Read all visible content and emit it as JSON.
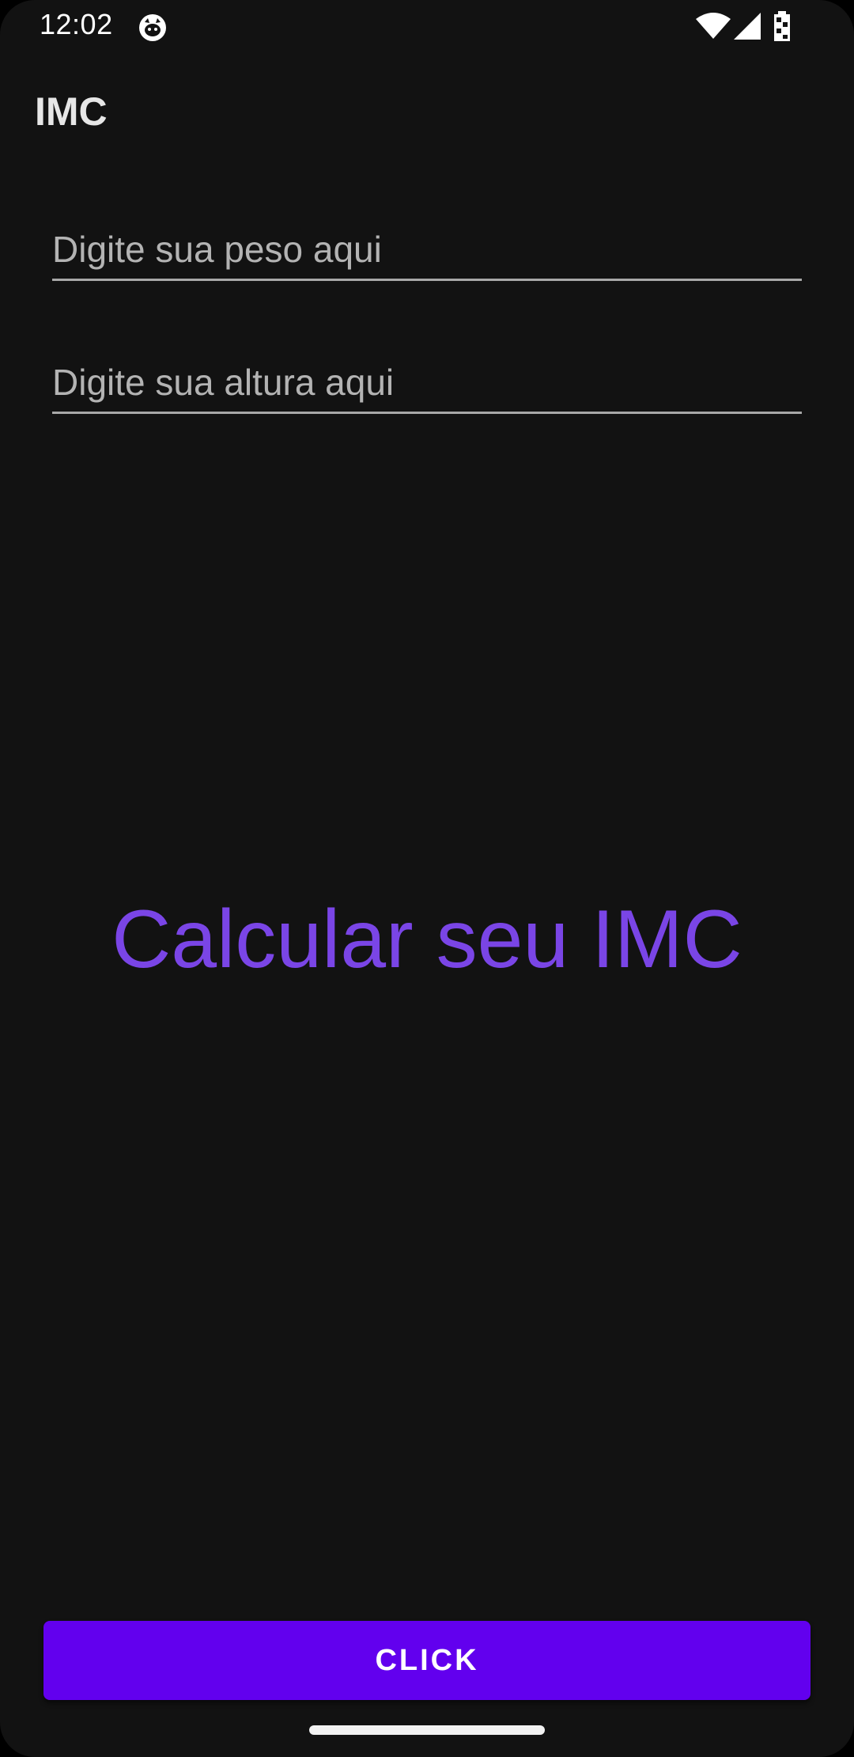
{
  "status_bar": {
    "time": "12:02",
    "icons": [
      "cat-notification-icon",
      "wifi-icon",
      "cell-signal-icon",
      "battery-icon"
    ]
  },
  "toolbar": {
    "title": "IMC"
  },
  "form": {
    "weight_placeholder": "Digite sua peso aqui",
    "weight_value": "",
    "height_placeholder": "Digite sua altura aqui",
    "height_value": ""
  },
  "result": {
    "text": "Calcular seu IMC"
  },
  "actions": {
    "click_label": "CLICK"
  },
  "colors": {
    "background": "#121212",
    "accent_text": "#7a45e6",
    "button": "#6200ee",
    "input_underline": "#a8a8a8"
  }
}
